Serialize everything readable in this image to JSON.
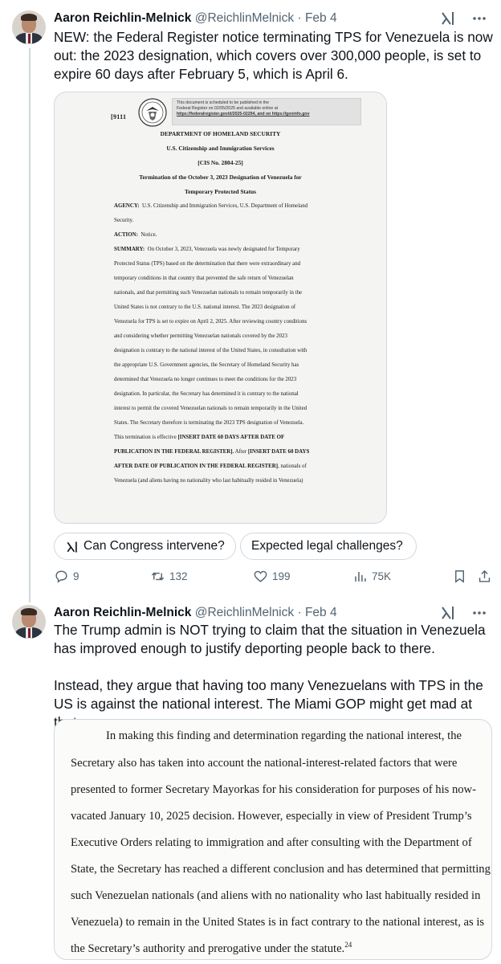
{
  "tweets": [
    {
      "author_name": "Aaron Reichlin-Melnick",
      "handle": "@ReichlinMelnick",
      "separator": "·",
      "date": "Feb 4",
      "text_paragraphs": [
        "NEW: the Federal Register notice terminating TPS for Venezuela is now out: the 2023 designation, which covers over 300,000 people, is set to expire 60 days after February 5, which is April 6."
      ],
      "document_image": {
        "doc_number": "[9111",
        "pub_note": [
          "This document is scheduled to be published in the",
          "Federal Register on 02/05/2025 and available online at",
          "https://federalregister.gov/d/2025-02294, and on https://govinfo.gov"
        ],
        "heading_lines": [
          "DEPARTMENT OF HOMELAND SECURITY",
          "U.S. Citizenship and Immigration Services",
          "[CIS No. 2804-25]",
          "Termination of the October 3, 2023 Designation of Venezuela for",
          "Temporary Protected Status"
        ],
        "agency_label": "AGENCY:",
        "agency_text_1": "U.S. Citizenship and Immigration Services, U.S. Department of Homeland",
        "agency_text_2": "Security.",
        "action_label": "ACTION:",
        "action_text": "Notice.",
        "summary_label": "SUMMARY:",
        "summary_first": "On October 3, 2023, Venezuela was newly designated for Temporary",
        "summary_lines": [
          "Protected Status (TPS) based on the determination that there were extraordinary and",
          "temporary conditions in that country that prevented the safe return of Venezuelan",
          "nationals, and that permitting such Venezuelan nationals to remain temporarily in the",
          "United States is not contrary to the U.S. national interest.  The 2023 designation of",
          "Venezuela for TPS is set to expire on April 2, 2025.  After reviewing country conditions",
          "and considering whether permitting Venezuelan nationals covered by the 2023",
          "designation is contrary to the national interest of the United States, in consultation with",
          "the appropriate U.S. Government agencies, the Secretary of Homeland Security has",
          "determined that Venezuela no longer continues to meet the conditions for the 2023",
          "designation.  In particular, the Secretary has determined it is contrary to the national",
          "interest to permit the covered Venezuelan nationals to remain temporarily in the United",
          "States.  The Secretary therefore is terminating the 2023 TPS designation of Venezuela."
        ],
        "effective_text": "This termination is effective ",
        "effective_bold": "[INSERT DATE 60 DAYS AFTER DATE OF",
        "pub_bold": "PUBLICATION IN THE FEDERAL REGISTER].",
        "after_text": "  After ",
        "after_bold": "[INSERT DATE 60 DAYS",
        "after2_bold": "AFTER DATE OF PUBLICATION IN THE FEDERAL REGISTER]",
        "after2_text": ", nationals of",
        "last_line": "Venezuela (and aliens having no nationality who last habitually resided in Venezuela)"
      },
      "chips": [
        "Can Congress intervene?",
        "Expected legal challenges?"
      ],
      "stats": {
        "replies": "9",
        "reposts": "132",
        "likes": "199",
        "views": "75K"
      }
    },
    {
      "author_name": "Aaron Reichlin-Melnick",
      "handle": "@ReichlinMelnick",
      "separator": "·",
      "date": "Feb 4",
      "text_paragraphs": [
        "The Trump admin is NOT trying to claim that the situation in Venezuela has improved enough to justify deporting people back to there.",
        "Instead, they argue that having too many Venezuelans with TPS in the US is against the national interest. The Miami GOP might get mad at that."
      ],
      "quote_image": {
        "lines": [
          "In making this finding and determination regarding the national interest, the",
          "Secretary also has taken into account the national-interest-related factors that were",
          "presented to former Secretary Mayorkas for his consideration for purposes of his now-",
          "vacated January 10, 2025 decision.  However, especially in view of President Trump’s",
          "Executive Orders relating to immigration and after consulting with the Department of",
          "State, the Secretary has reached a different conclusion and has determined that permitting",
          "such Venezuelan nationals (and aliens with no nationality who last habitually resided in",
          "Venezuela) to remain in the United States is in fact contrary to the national interest, as is",
          "the Secretary’s authority and prerogative under the statute."
        ],
        "footnote": "24"
      }
    }
  ]
}
